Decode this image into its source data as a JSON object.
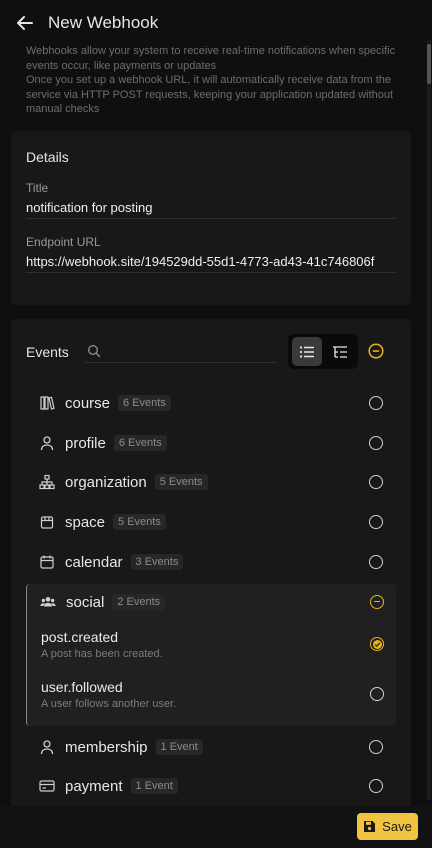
{
  "header": {
    "title": "New Webhook"
  },
  "description": [
    "Webhooks allow your system to receive real-time notifications when specific events occur, like payments or updates",
    "Once you set up a webhook URL, it will automatically receive data from the service via HTTP POST requests, keeping your application updated without manual checks"
  ],
  "details": {
    "heading": "Details",
    "title_label": "Title",
    "title_value": "notification for posting",
    "url_label": "Endpoint URL",
    "url_value": "https://webhook.site/194529dd-55d1-4773-ad43-41c746806f"
  },
  "events": {
    "heading": "Events",
    "search_placeholder": "",
    "groups": [
      {
        "icon": "books-icon",
        "name": "course",
        "count": "6 Events",
        "state": "unchecked"
      },
      {
        "icon": "user-icon",
        "name": "profile",
        "count": "6 Events",
        "state": "unchecked"
      },
      {
        "icon": "org-chart-icon",
        "name": "organization",
        "count": "5 Events",
        "state": "unchecked"
      },
      {
        "icon": "bag-icon",
        "name": "space",
        "count": "5 Events",
        "state": "unchecked"
      },
      {
        "icon": "calendar-icon",
        "name": "calendar",
        "count": "3 Events",
        "state": "unchecked"
      },
      {
        "icon": "people-icon",
        "name": "social",
        "count": "2 Events",
        "state": "partial",
        "expanded": true,
        "items": [
          {
            "name": "post.created",
            "description": "A post has been created.",
            "checked": true
          },
          {
            "name": "user.followed",
            "description": "A user follows another user.",
            "checked": false
          }
        ]
      },
      {
        "icon": "user-icon",
        "name": "membership",
        "count": "1 Event",
        "state": "unchecked"
      },
      {
        "icon": "card-icon",
        "name": "payment",
        "count": "1 Event",
        "state": "unchecked"
      }
    ]
  },
  "footer": {
    "save_label": "Save"
  },
  "colors": {
    "accent": "#f0c341",
    "background": "#0f0f0f",
    "card": "#181818"
  }
}
